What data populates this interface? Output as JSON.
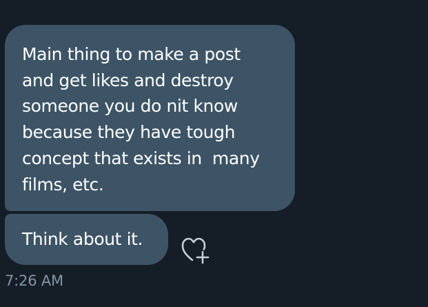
{
  "messages": [
    {
      "text": "Main thing to make a post\nand get likes and destroy\nsomeone you do nit know\nbecause they have tough\nconcept that exists in  many\nfilms, etc."
    },
    {
      "text": "Think about it."
    }
  ],
  "timestamp": "7:26 AM",
  "icons": {
    "react": "add-reaction-heart-icon"
  },
  "colors": {
    "background": "#151d26",
    "bubble": "#3d5466",
    "message_text": "#ffffff",
    "timestamp_text": "#8596a6"
  }
}
